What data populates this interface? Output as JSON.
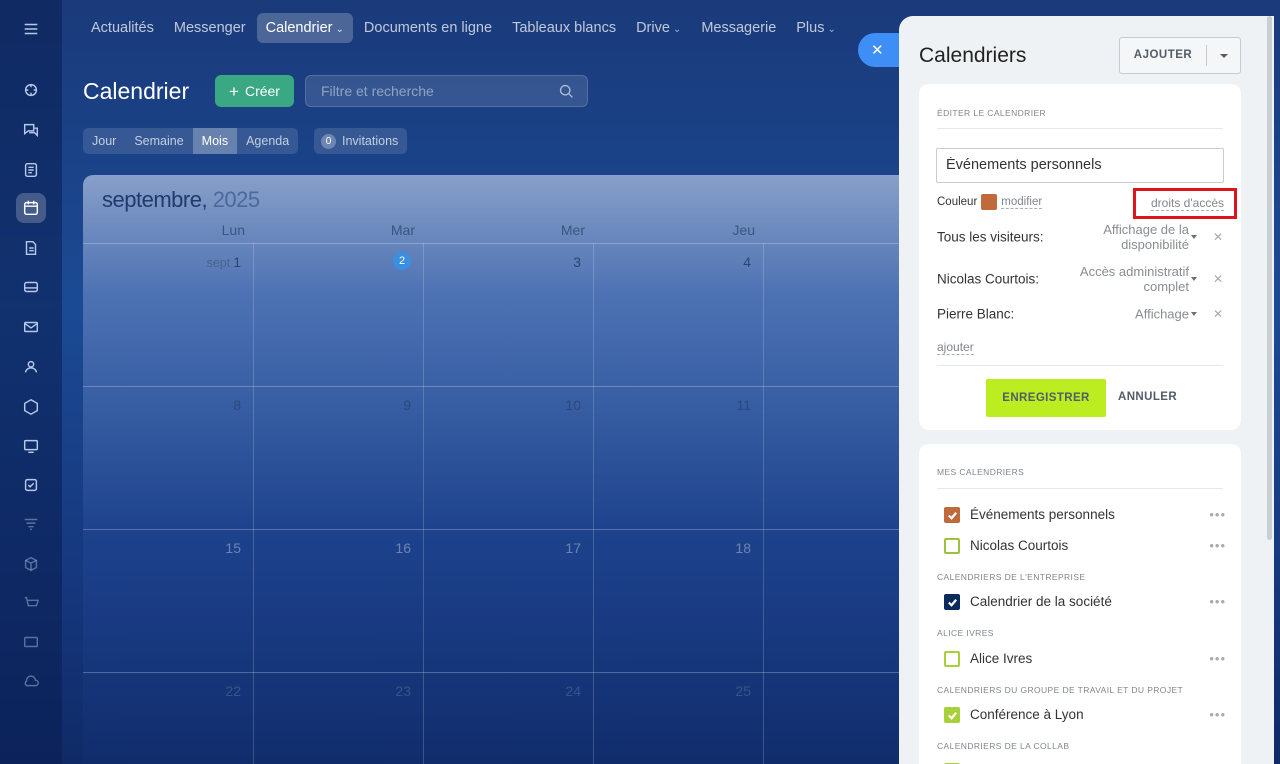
{
  "topnav": {
    "items": [
      "Actualités",
      "Messenger",
      "Calendrier",
      "Documents en ligne",
      "Tableaux blancs",
      "Drive",
      "Messagerie",
      "Plus"
    ]
  },
  "header": {
    "title": "Calendrier",
    "create_label": "Créer",
    "search_placeholder": "Filtre et recherche"
  },
  "view_tabs": [
    "Jour",
    "Semaine",
    "Mois",
    "Agenda"
  ],
  "invitations": {
    "count": "0",
    "label": "Invitations"
  },
  "calendar": {
    "month": "septembre,",
    "year": "2025",
    "weekdays": [
      "Lun",
      "Mar",
      "Mer",
      "Jeu"
    ],
    "first_day_prefix": "sept",
    "weeks": [
      [
        "1",
        "2",
        "3",
        "4"
      ],
      [
        "8",
        "9",
        "10",
        "11"
      ],
      [
        "15",
        "16",
        "17",
        "18"
      ],
      [
        "22",
        "23",
        "24",
        "25"
      ]
    ]
  },
  "panel": {
    "title": "Calendriers",
    "add_label": "AJOUTER",
    "edit": {
      "section_label": "ÉDITER LE CALENDRIER",
      "name_value": "Événements personnels",
      "color_label": "Couleur",
      "color_value": "#c0693a",
      "modify_label": "modifier",
      "access_rights_label": "droits d'accès",
      "permissions": [
        {
          "who": "Tous les visiteurs:",
          "level_line1": "Affichage de la",
          "level_line2": "disponibilité"
        },
        {
          "who": "Nicolas Courtois:",
          "level_line1": "Accès administratif",
          "level_line2": "complet"
        },
        {
          "who": "Pierre Blanc:",
          "level_line1": "Affichage",
          "level_line2": ""
        }
      ],
      "add_link": "ajouter",
      "save_label": "ENREGISTRER",
      "cancel_label": "ANNULER"
    },
    "my_calendars": {
      "section_label": "MES CALENDRIERS",
      "items": [
        {
          "name": "Événements personnels",
          "checked": true,
          "color": "#c0693a"
        },
        {
          "name": "Nicolas Courtois",
          "checked": false,
          "color": "#9dc13a"
        }
      ]
    },
    "company": {
      "section_label": "CALENDRIERS DE L'ENTREPRISE",
      "items": [
        {
          "name": "Calendrier de la société",
          "checked": true,
          "color": "#0b2b5c"
        }
      ]
    },
    "alice": {
      "section_label": "ALICE IVRES",
      "items": [
        {
          "name": "Alice Ivres",
          "checked": false,
          "color": "#a8d03a"
        }
      ]
    },
    "groups": {
      "section_label": "CALENDRIERS DU GROUPE DE TRAVAIL ET DU PROJET",
      "items": [
        {
          "name": "Conférence à Lyon",
          "checked": true,
          "color": "#a8d03a"
        }
      ]
    },
    "collab": {
      "section_label": "CALENDRIERS DE LA COLLAB"
    }
  }
}
